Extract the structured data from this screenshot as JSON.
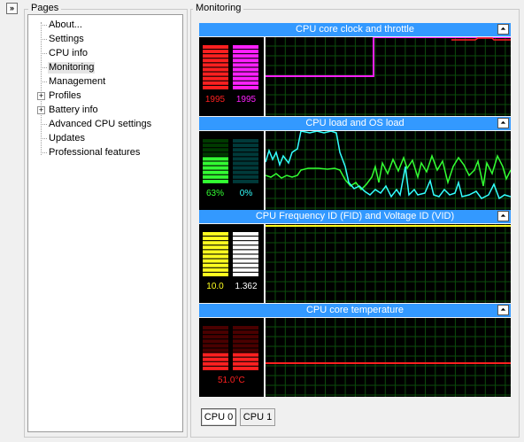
{
  "collapse_glyph": "»",
  "pages": {
    "title": "Pages",
    "items": [
      {
        "label": "About...",
        "expandable": false
      },
      {
        "label": "Settings",
        "expandable": false
      },
      {
        "label": "CPU info",
        "expandable": false
      },
      {
        "label": "Monitoring",
        "expandable": false,
        "selected": true
      },
      {
        "label": "Management",
        "expandable": false
      },
      {
        "label": "Profiles",
        "expandable": true
      },
      {
        "label": "Battery info",
        "expandable": true
      },
      {
        "label": "Advanced CPU settings",
        "expandable": false
      },
      {
        "label": "Updates",
        "expandable": false
      },
      {
        "label": "Professional features",
        "expandable": false
      }
    ],
    "expander_glyph": "+"
  },
  "monitoring": {
    "title": "Monitoring",
    "collapse_glyph": "⏶",
    "panels": [
      {
        "title": "CPU core clock and throttle",
        "meters": [
          {
            "value": "1995",
            "color": "#ff2020",
            "dim": "#4a0000",
            "level": 1.0
          },
          {
            "value": "1995",
            "color": "#ff20ff",
            "dim": "#4a004a",
            "level": 1.0
          }
        ]
      },
      {
        "title": "CPU load and OS load",
        "meters": [
          {
            "value": "63%",
            "color": "#33ff33",
            "dim": "#003a00",
            "level": 0.63
          },
          {
            "value": "0%",
            "color": "#33ffff",
            "dim": "#003a3a",
            "level": 0.0
          }
        ]
      },
      {
        "title": "CPU Frequency ID (FID) and Voltage ID (VID)",
        "meters": [
          {
            "value": "10.0",
            "color": "#ffff20",
            "dim": "#3a3a00",
            "level": 1.0
          },
          {
            "value": "1.362",
            "color": "#ffffff",
            "dim": "#3a3a3a",
            "level": 1.0
          }
        ]
      },
      {
        "title": "CPU core temperature",
        "meters": [
          {
            "value": "51.0°C",
            "color": "#ff2020",
            "dim": "#4a0000",
            "level": 0.35
          }
        ]
      }
    ],
    "cpu_tabs": [
      {
        "label": "CPU 0",
        "active": true
      },
      {
        "label": "CPU 1",
        "active": false
      }
    ]
  }
}
